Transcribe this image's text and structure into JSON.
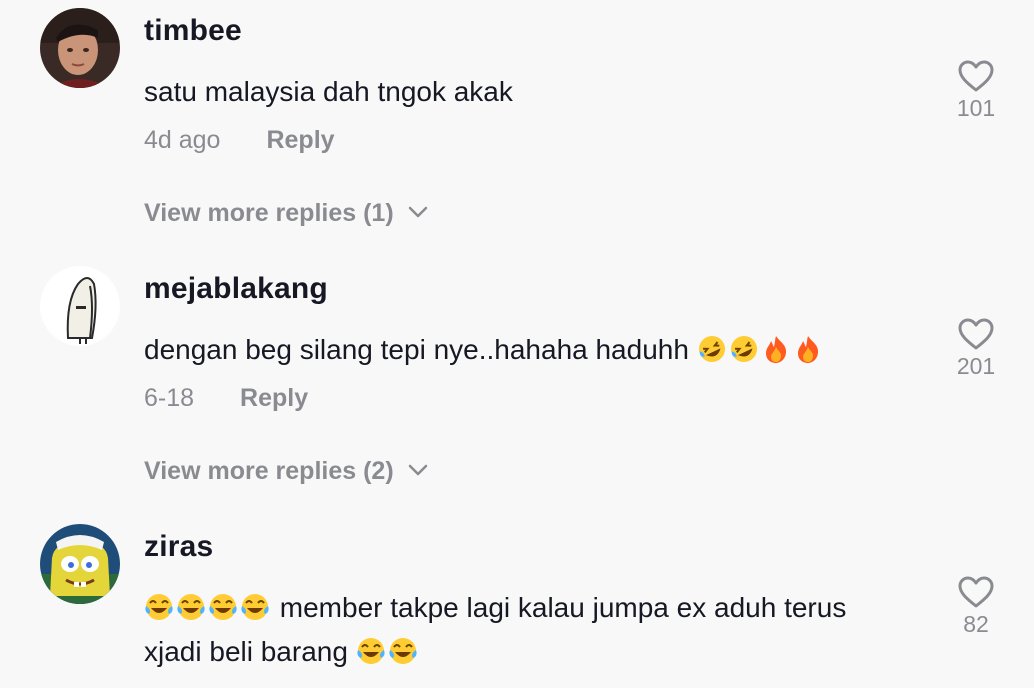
{
  "comments": [
    {
      "username": "timbee",
      "text": "satu malaysia dah tngok akak",
      "date": "4d ago",
      "reply_label": "Reply",
      "view_more": "View more replies (1)",
      "likes": "101"
    },
    {
      "username": "mejablakang",
      "text": "dengan beg silang tepi nye..hahaha haduhh",
      "emojis": [
        "rolling-laughing",
        "rolling-laughing",
        "fire",
        "fire"
      ],
      "date": "6-18",
      "reply_label": "Reply",
      "view_more": "View more replies (2)",
      "likes": "201"
    },
    {
      "username": "ziras",
      "text_before": "member takpe lagi kalau jumpa ex aduh terus",
      "text_after": "xjadi beli barang",
      "emojis_lead": [
        "tears-of-joy",
        "tears-of-joy",
        "tears-of-joy",
        "tears-of-joy"
      ],
      "emojis_trail": [
        "tears-of-joy",
        "tears-of-joy"
      ],
      "likes": "82"
    }
  ],
  "colors": {
    "background": "#f8f8f8",
    "primary_text": "#161823",
    "secondary_text": "#8a8b91"
  }
}
